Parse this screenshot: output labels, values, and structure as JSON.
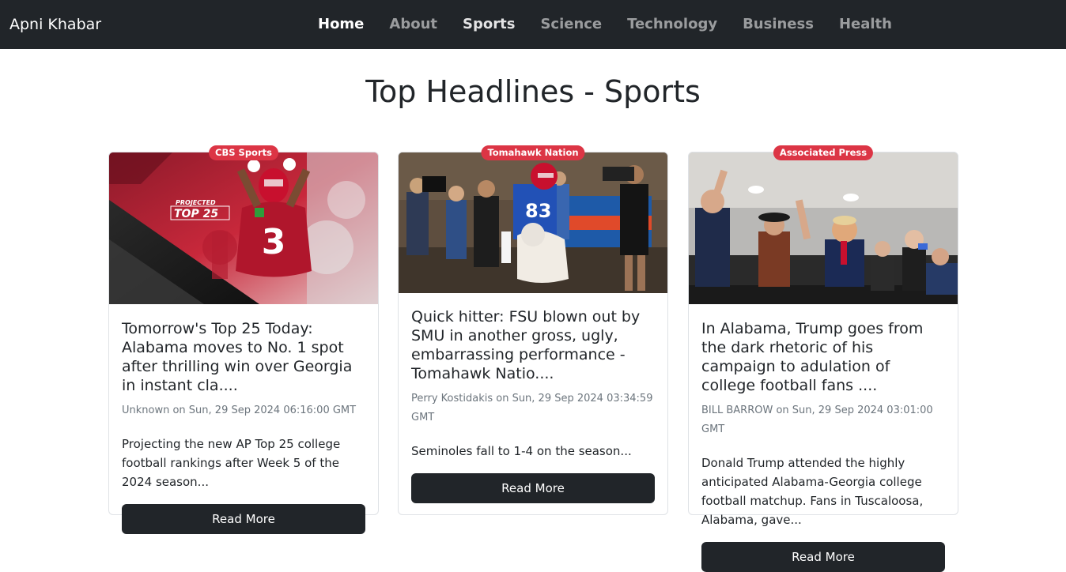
{
  "navbar": {
    "brand": "Apni Khabar",
    "links": [
      {
        "label": "Home"
      },
      {
        "label": "About"
      },
      {
        "label": "Sports"
      },
      {
        "label": "Science"
      },
      {
        "label": "Technology"
      },
      {
        "label": "Business"
      },
      {
        "label": "Health"
      }
    ]
  },
  "page": {
    "title": "Top Headlines - Sports"
  },
  "articles": [
    {
      "source": "CBS Sports",
      "image_text": "PROJECTED",
      "image_text_2": "TOP 25",
      "image_number": "3",
      "title": "Tomorrow's Top 25 Today: Alabama moves to No. 1 spot after thrilling win over Georgia in instant cla....",
      "meta": "Unknown on Sun, 29 Sep 2024 06:16:00 GMT",
      "description": "Projecting the new AP Top 25 college football rankings after Week 5 of the 2024 season...",
      "button": "Read More"
    },
    {
      "source": "Tomahawk Nation",
      "image_jersey": "83",
      "title": "Quick hitter: FSU blown out by SMU in another gross, ugly, embarrassing performance - Tomahawk Natio....",
      "meta": "Perry Kostidakis on Sun, 29 Sep 2024 03:34:59 GMT",
      "description": "Seminoles fall to 1-4 on the season...",
      "button": "Read More"
    },
    {
      "source": "Associated Press",
      "title": "In Alabama, Trump goes from the dark rhetoric of his campaign to adulation of college football fans ....",
      "meta": "BILL BARROW on Sun, 29 Sep 2024 03:01:00 GMT",
      "description": "Donald Trump attended the highly anticipated Alabama-Georgia college football matchup. Fans in Tuscaloosa, Alabama, gave...",
      "button": "Read More"
    }
  ],
  "colors": {
    "navbar_bg": "#212529",
    "badge_bg": "#dc3545",
    "button_bg": "#212529"
  }
}
